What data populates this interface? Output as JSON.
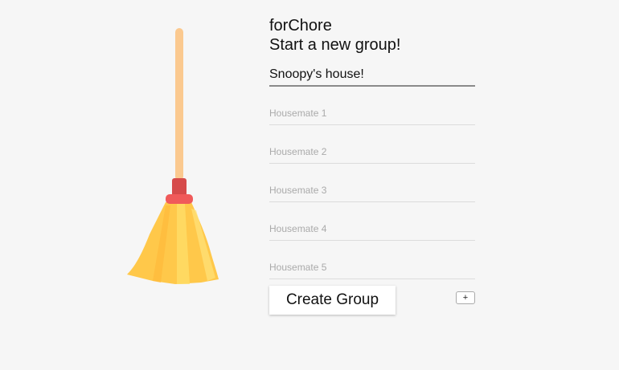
{
  "app": {
    "title": "forChore",
    "subtitle": "Start a new group!"
  },
  "group_name": {
    "value": "Snoopy's house!"
  },
  "housemates": [
    {
      "placeholder": "Housemate 1"
    },
    {
      "placeholder": "Housemate 2"
    },
    {
      "placeholder": "Housemate 3"
    },
    {
      "placeholder": "Housemate 4"
    },
    {
      "placeholder": "Housemate 5"
    }
  ],
  "actions": {
    "create_label": "Create Group",
    "add_label": "+"
  },
  "illustration": {
    "icon": "broom-icon",
    "colors": {
      "handle": "#fbc98f",
      "band": "#d64b4b",
      "ring": "#f05a5a",
      "bristles": "#ffc84a",
      "bristles_light": "#ffdd66"
    }
  }
}
